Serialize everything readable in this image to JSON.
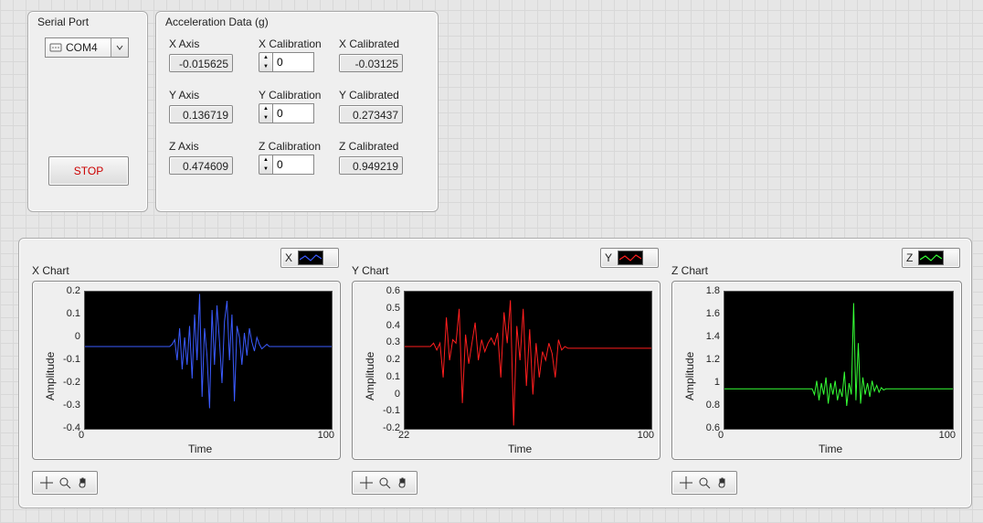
{
  "serial": {
    "group_title": "Serial Port",
    "value": "COM4"
  },
  "stop_label": "STOP",
  "accel": {
    "group_title": "Acceleration Data (g)",
    "rows": {
      "x": {
        "axis_label": "X Axis",
        "axis_value": "-0.015625",
        "cal_label": "X Calibration",
        "cal_value": "0",
        "calib_label": "X Calibrated",
        "calib_value": "-0.03125"
      },
      "y": {
        "axis_label": "Y Axis",
        "axis_value": "0.136719",
        "cal_label": "Y Calibration",
        "cal_value": "0",
        "calib_label": "Y Calibrated",
        "calib_value": "0.273437"
      },
      "z": {
        "axis_label": "Z Axis",
        "axis_value": "0.474609",
        "cal_label": "Z Calibration",
        "cal_value": "0",
        "calib_label": "Z Calibrated",
        "calib_value": "0.949219"
      }
    }
  },
  "charts": {
    "x": {
      "title": "X Chart",
      "legend": "X",
      "color": "#3b5bff",
      "xlabel": "Time",
      "ylabel": "Amplitude",
      "x_ticks": [
        "0",
        "100"
      ],
      "y_ticks": [
        "0.2",
        "0.1",
        "0",
        "-0.1",
        "-0.2",
        "-0.3",
        "-0.4"
      ]
    },
    "y": {
      "title": "Y Chart",
      "legend": "Y",
      "color": "#ff1e1e",
      "xlabel": "Time",
      "ylabel": "Amplitude",
      "x_ticks": [
        "22",
        "100"
      ],
      "y_ticks": [
        "0.6",
        "0.5",
        "0.4",
        "0.3",
        "0.2",
        "0.1",
        "0",
        "-0.1",
        "-0.2"
      ]
    },
    "z": {
      "title": "Z Chart",
      "legend": "Z",
      "color": "#35ff35",
      "xlabel": "Time",
      "ylabel": "Amplitude",
      "x_ticks": [
        "0",
        "100"
      ],
      "y_ticks": [
        "1.8",
        "1.6",
        "1.4",
        "1.2",
        "1",
        "0.8",
        "0.6"
      ]
    }
  },
  "chart_data": [
    {
      "type": "line",
      "title": "X Chart",
      "xlabel": "Time",
      "ylabel": "Amplitude",
      "xlim": [
        0,
        100
      ],
      "ylim": [
        -0.4,
        0.2
      ],
      "series_name": "X",
      "color": "#3b5bff",
      "values": [
        -0.04,
        -0.04,
        -0.04,
        -0.04,
        -0.04,
        -0.04,
        -0.04,
        -0.04,
        -0.04,
        -0.04,
        -0.04,
        -0.04,
        -0.04,
        -0.04,
        -0.04,
        -0.04,
        -0.04,
        -0.04,
        -0.04,
        -0.04,
        -0.04,
        -0.04,
        -0.04,
        -0.04,
        -0.04,
        -0.04,
        -0.04,
        -0.04,
        -0.04,
        -0.04,
        -0.04,
        -0.04,
        -0.04,
        -0.04,
        -0.04,
        -0.03,
        -0.01,
        -0.1,
        0.04,
        -0.14,
        0.0,
        -0.12,
        0.05,
        -0.18,
        0.1,
        -0.1,
        0.19,
        -0.26,
        0.04,
        -0.08,
        -0.31,
        0.12,
        -0.12,
        0.14,
        -0.02,
        -0.2,
        0.07,
        0.16,
        -0.1,
        0.1,
        -0.28,
        0.05,
        0.0,
        -0.12,
        0.02,
        -0.08,
        0.04,
        -0.02,
        -0.06,
        0.0,
        -0.03,
        -0.05,
        -0.04,
        -0.03,
        -0.04,
        -0.04,
        -0.04,
        -0.04,
        -0.04,
        -0.04,
        -0.04,
        -0.04,
        -0.04,
        -0.04,
        -0.04,
        -0.04,
        -0.04,
        -0.04,
        -0.04,
        -0.04,
        -0.04,
        -0.04,
        -0.04,
        -0.04,
        -0.04,
        -0.04,
        -0.04,
        -0.04,
        -0.04,
        -0.04
      ]
    },
    {
      "type": "line",
      "title": "Y Chart",
      "xlabel": "Time",
      "ylabel": "Amplitude",
      "xlim": [
        22,
        100
      ],
      "ylim": [
        -0.2,
        0.6
      ],
      "series_name": "Y",
      "color": "#ff1e1e",
      "values": [
        0.28,
        0.28,
        0.28,
        0.28,
        0.28,
        0.28,
        0.28,
        0.28,
        0.28,
        0.3,
        0.26,
        0.3,
        0.1,
        0.45,
        0.2,
        0.32,
        0.3,
        0.5,
        -0.05,
        0.35,
        0.18,
        0.3,
        0.42,
        0.2,
        0.32,
        0.25,
        0.3,
        0.33,
        0.29,
        0.36,
        0.1,
        0.48,
        0.3,
        0.55,
        -0.18,
        0.4,
        0.2,
        0.5,
        0.05,
        0.38,
        0.0,
        0.3,
        0.1,
        0.25,
        0.2,
        0.3,
        0.24,
        0.1,
        0.32,
        0.26,
        0.28,
        0.27,
        0.27,
        0.27,
        0.27,
        0.27,
        0.27,
        0.27,
        0.27,
        0.27,
        0.27,
        0.27,
        0.27,
        0.27,
        0.27,
        0.27,
        0.27,
        0.27,
        0.27,
        0.27,
        0.27,
        0.27,
        0.27,
        0.27,
        0.27,
        0.27,
        0.27,
        0.27
      ]
    },
    {
      "type": "line",
      "title": "Z Chart",
      "xlabel": "Time",
      "ylabel": "Amplitude",
      "xlim": [
        0,
        100
      ],
      "ylim": [
        0.6,
        1.8
      ],
      "series_name": "Z",
      "color": "#35ff35",
      "values": [
        0.95,
        0.95,
        0.95,
        0.95,
        0.95,
        0.95,
        0.95,
        0.95,
        0.95,
        0.95,
        0.95,
        0.95,
        0.95,
        0.95,
        0.95,
        0.95,
        0.95,
        0.95,
        0.95,
        0.95,
        0.95,
        0.95,
        0.95,
        0.95,
        0.95,
        0.95,
        0.95,
        0.95,
        0.95,
        0.95,
        0.95,
        0.95,
        0.95,
        0.95,
        0.95,
        0.95,
        0.95,
        0.95,
        0.95,
        0.9,
        1.02,
        0.85,
        1.0,
        0.9,
        1.05,
        0.82,
        1.0,
        0.9,
        1.02,
        0.85,
        0.95,
        0.88,
        1.1,
        0.8,
        1.0,
        0.9,
        1.7,
        0.85,
        1.35,
        0.82,
        1.05,
        0.9,
        1.0,
        0.88,
        1.02,
        0.93,
        0.98,
        0.92,
        0.96,
        0.94,
        0.95,
        0.95,
        0.95,
        0.95,
        0.95,
        0.95,
        0.95,
        0.95,
        0.95,
        0.95,
        0.95,
        0.95,
        0.95,
        0.95,
        0.95,
        0.95,
        0.95,
        0.95,
        0.95,
        0.95,
        0.95,
        0.95,
        0.95,
        0.95,
        0.95,
        0.95,
        0.95,
        0.95,
        0.95,
        0.95
      ]
    }
  ]
}
